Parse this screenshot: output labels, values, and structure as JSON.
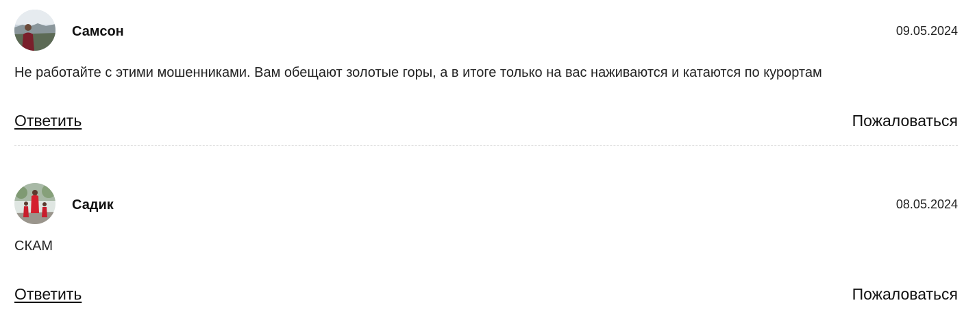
{
  "comments": [
    {
      "author": "Самсон",
      "date": "09.05.2024",
      "text": "Не работайте с этими мошенниками. Вам обещают золотые горы, а в итоге только на вас наживаются и катаются по курортам",
      "reply_label": "Ответить",
      "report_label": "Пожаловаться"
    },
    {
      "author": "Садик",
      "date": "08.05.2024",
      "text": "СКАМ",
      "reply_label": "Ответить",
      "report_label": "Пожаловаться"
    }
  ]
}
